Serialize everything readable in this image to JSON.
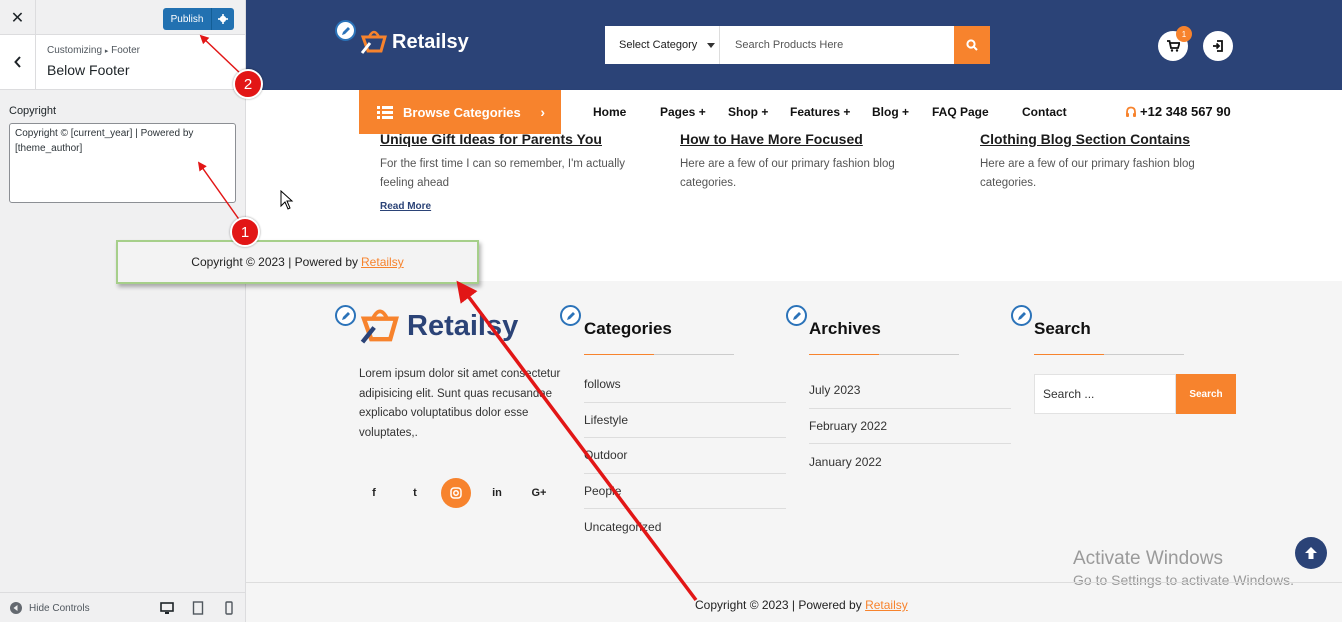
{
  "customizer": {
    "close_label": "✕",
    "publish_label": "Publish",
    "breadcrumb_root": "Customizing",
    "breadcrumb_sep": "▸",
    "breadcrumb_parent": "Footer",
    "section_title": "Below Footer",
    "field_label": "Copyright",
    "field_value": "Copyright © [current_year] | Powered by [theme_author]",
    "hide_controls_label": "Hide Controls"
  },
  "site": {
    "logo_text": "Retailsy",
    "category_select": "Select Category",
    "search_placeholder": "Search Products Here",
    "cart_count": "1",
    "browse_label": "Browse Categories",
    "nav": [
      {
        "label": "Home"
      },
      {
        "label": "Pages +"
      },
      {
        "label": "Shop +"
      },
      {
        "label": "Features +"
      },
      {
        "label": "Blog +"
      },
      {
        "label": "FAQ Page"
      },
      {
        "label": "Contact"
      }
    ],
    "phone": "+12 348 567 90"
  },
  "posts": [
    {
      "title": "Unique Gift Ideas for Parents You",
      "excerpt": "For the first time I can so remember, I'm actually feeling ahead",
      "read_more": "Read More"
    },
    {
      "title": "How to Have More Focused",
      "excerpt": "Here are a few of our primary fashion blog categories."
    },
    {
      "title": "Clothing Blog Section Contains",
      "excerpt": "Here are a few of our primary fashion blog categories."
    }
  ],
  "footer": {
    "about": "Lorem ipsum dolor sit amet consectetur adipisicing elit. Sunt quas recusandae explicabo voluptatibus dolor esse voluptates,.",
    "social": [
      {
        "label": "f",
        "icon": "facebook-icon"
      },
      {
        "label": "t",
        "icon": "twitter-icon"
      },
      {
        "label": "ig",
        "icon": "instagram-icon"
      },
      {
        "label": "in",
        "icon": "linkedin-icon"
      },
      {
        "label": "G+",
        "icon": "google-plus-icon"
      }
    ],
    "categories_title": "Categories",
    "categories": [
      "follows",
      "Lifestyle",
      "Outdoor",
      "People",
      "Uncategorized"
    ],
    "archives_title": "Archives",
    "archives": [
      "July 2023",
      "February 2022",
      "January 2022"
    ],
    "search_title": "Search",
    "search_placeholder": "Search ...",
    "search_button": "Search",
    "copyright_prefix": "Copyright © 2023 | Powered by",
    "copyright_author": "Retailsy"
  },
  "annotation": {
    "callout_prefix": "Copyright © 2023 | Powered by",
    "callout_author": "Retailsy",
    "marker_1": "1",
    "marker_2": "2"
  },
  "watermark": {
    "line1": "Activate Windows",
    "line2": "Go to Settings to activate Windows."
  },
  "colors": {
    "brand_blue": "#2b4377",
    "accent_orange": "#f7832d",
    "wp_blue": "#2271b1",
    "annotation_red": "#e21616"
  }
}
